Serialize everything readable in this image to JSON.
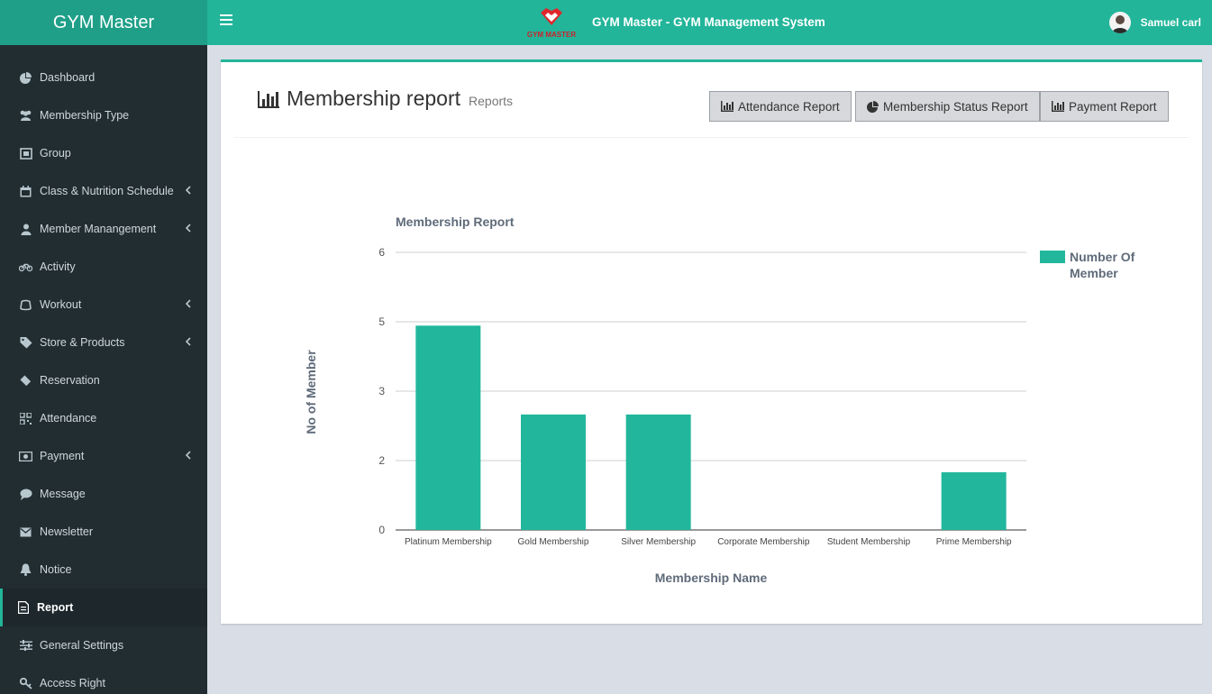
{
  "header": {
    "brand": "GYM Master",
    "app_title": "GYM Master - GYM Management System",
    "logo_text": "GYM MASTER",
    "user_name": "Samuel carl"
  },
  "sidebar": {
    "items": [
      {
        "label": "Dashboard",
        "icon": "dashboard-icon",
        "submenu": false,
        "active": false
      },
      {
        "label": "Membership Type",
        "icon": "users-icon",
        "submenu": false,
        "active": false
      },
      {
        "label": "Group",
        "icon": "group-icon",
        "submenu": false,
        "active": false
      },
      {
        "label": "Class & Nutrition Schedule",
        "icon": "calendar-icon",
        "submenu": true,
        "active": false
      },
      {
        "label": "Member Manangement",
        "icon": "user-icon",
        "submenu": true,
        "active": false
      },
      {
        "label": "Activity",
        "icon": "bicycle-icon",
        "submenu": false,
        "active": false
      },
      {
        "label": "Workout",
        "icon": "workout-icon",
        "submenu": true,
        "active": false
      },
      {
        "label": "Store & Products",
        "icon": "tag-icon",
        "submenu": true,
        "active": false
      },
      {
        "label": "Reservation",
        "icon": "ticket-icon",
        "submenu": false,
        "active": false
      },
      {
        "label": "Attendance",
        "icon": "qrcode-icon",
        "submenu": false,
        "active": false
      },
      {
        "label": "Payment",
        "icon": "money-icon",
        "submenu": true,
        "active": false
      },
      {
        "label": "Message",
        "icon": "comment-icon",
        "submenu": false,
        "active": false
      },
      {
        "label": "Newsletter",
        "icon": "envelope-icon",
        "submenu": false,
        "active": false
      },
      {
        "label": "Notice",
        "icon": "bell-icon",
        "submenu": false,
        "active": false
      },
      {
        "label": "Report",
        "icon": "file-icon",
        "submenu": false,
        "active": true
      },
      {
        "label": "General Settings",
        "icon": "sliders-icon",
        "submenu": false,
        "active": false
      },
      {
        "label": "Access Right",
        "icon": "key-icon",
        "submenu": false,
        "active": false
      }
    ]
  },
  "page": {
    "title": "Membership report",
    "subtitle": "Reports",
    "buttons": {
      "attendance": "Attendance Report",
      "membership_status": "Membership Status Report",
      "payment": "Payment Report"
    }
  },
  "colors": {
    "accent": "#22b59a",
    "sidebar_bg": "#222d32",
    "bar": "#22b79c"
  },
  "chart_data": {
    "type": "bar",
    "title": "Membership Report",
    "xlabel": "Membership Name",
    "ylabel": "No of Member",
    "categories": [
      "Platinum Membership",
      "Gold Membership",
      "Silver Membership",
      "Corporate Membership",
      "Student Membership",
      "Prime Membership"
    ],
    "series": [
      {
        "name": "Number Of Member",
        "values": [
          4.6,
          2.6,
          2.6,
          0,
          0,
          1.3
        ]
      }
    ],
    "yticks": [
      "0",
      "2",
      "3",
      "5",
      "6"
    ],
    "ylim": [
      0,
      6
    ],
    "grid": true,
    "legend": "right"
  }
}
